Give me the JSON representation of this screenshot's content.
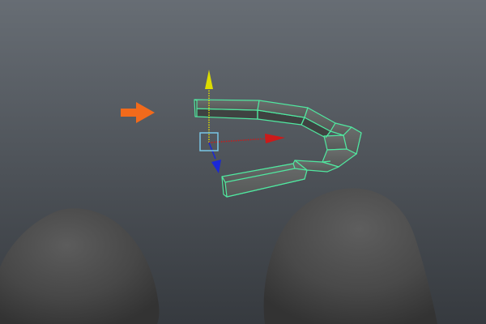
{
  "viewport": {
    "background_top": "#676d74",
    "background_bottom": "#363a3f"
  },
  "selected_object": {
    "wireframe_color": "#50e8a0",
    "face_color": "#5b5e5d",
    "side_color": "#3f4241"
  },
  "manipulator": {
    "y_axis_color": "#dcdc00",
    "x_axis_color": "#cc1a1a",
    "z_axis_color": "#1a28d8",
    "center_color": "#78c6e6"
  },
  "annotation": {
    "icon": "orange-arrow-icon",
    "color": "#f26a1b"
  },
  "scene_objects": {
    "color": "#4d4d4d",
    "highlight": "#5c5c5c"
  }
}
